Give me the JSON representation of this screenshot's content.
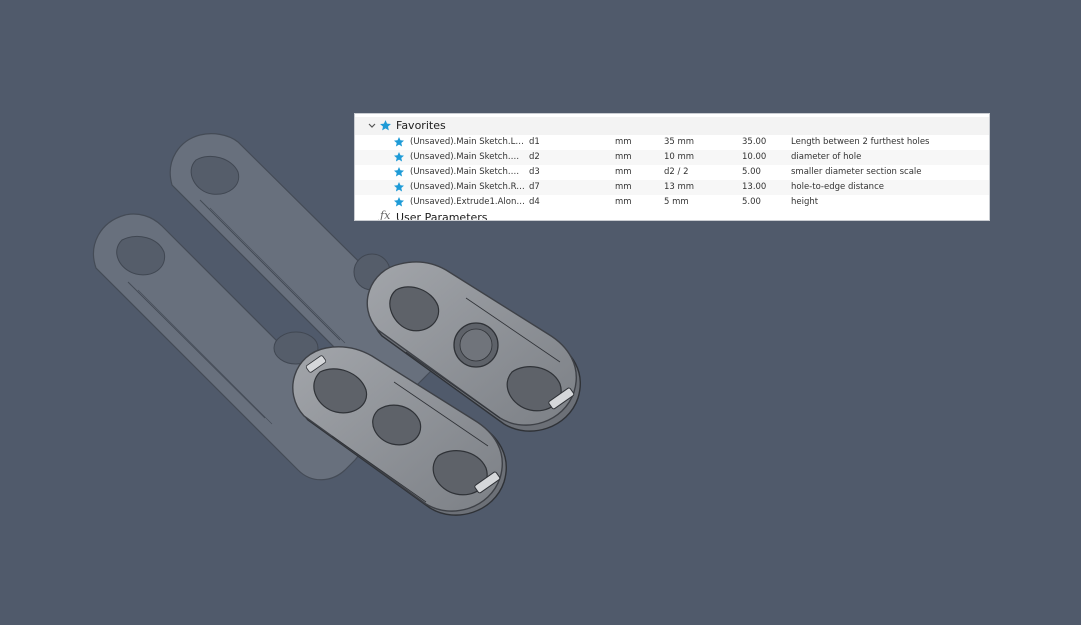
{
  "parameters": {
    "favorites_label": "Favorites",
    "user_params_label": "User Parameters",
    "rows": [
      {
        "name": "(Unsaved).Main Sketch.Lin...",
        "id": "d1",
        "unit": "mm",
        "expression": "35 mm",
        "value": "35.00",
        "comment": "Length between 2 furthest holes"
      },
      {
        "name": "(Unsaved).Main Sketch.Dia...",
        "id": "d2",
        "unit": "mm",
        "expression": "10 mm",
        "value": "10.00",
        "comment": "diameter of hole"
      },
      {
        "name": "(Unsaved).Main Sketch.Dia...",
        "id": "d3",
        "unit": "mm",
        "expression": "d2 / 2",
        "value": "5.00",
        "comment": "smaller diameter section scale"
      },
      {
        "name": "(Unsaved).Main Sketch.Ra...",
        "id": "d7",
        "unit": "mm",
        "expression": "13 mm",
        "value": "13.00",
        "comment": "hole-to-edge distance"
      },
      {
        "name": "(Unsaved).Extrude1.AlongD...",
        "id": "d4",
        "unit": "mm",
        "expression": "5 mm",
        "value": "5.00",
        "comment": "height"
      }
    ]
  },
  "colors": {
    "background": "#505a6b",
    "star": "#1e9bd7",
    "part_body": "#8e9196",
    "part_edge": "#3e4147"
  },
  "icons": {
    "favorites": "star-icon",
    "collapse": "chevron-down-icon",
    "user_params": "fx-icon"
  }
}
